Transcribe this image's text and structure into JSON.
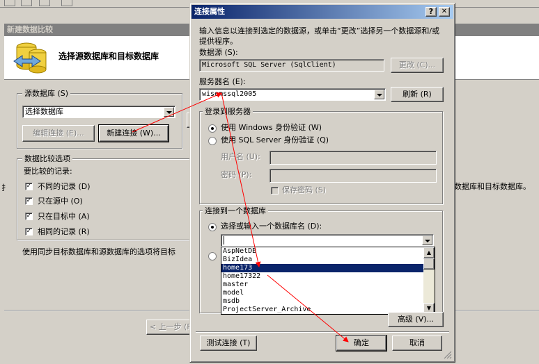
{
  "wizard": {
    "title": "新建数据比较",
    "header": "选择源数据库和目标数据库",
    "source_group": "源数据库 (S)",
    "source_select": "选择数据库",
    "edit_connection": "编辑连接 (E)...",
    "new_connection": "新建连接 (W)...",
    "options_group": "数据比较选项",
    "records_label": "要比较的记录:",
    "options": [
      {
        "label": "不同的记录 (D)",
        "checked": true
      },
      {
        "label": "只在源中 (O)",
        "checked": true
      },
      {
        "label": "只在目标中 (A)",
        "checked": true
      },
      {
        "label": "相同的记录 (R)",
        "checked": true
      }
    ],
    "sync_note": "使用同步目标数据库和源数据库的选项将目标",
    "right_text": "数据库和目标数据库。",
    "back_button": "< 上一步 (P"
  },
  "dialog": {
    "title": "连接属性",
    "help_button": "?",
    "close_button": "✕",
    "intro": "输入信息以连接到选定的数据源，或单击“更改”选择另一个数据源和/或提供程序。",
    "datasource_label": "数据源 (S):",
    "datasource_value": "Microsoft SQL Server (SqlClient)",
    "change_button": "更改 (C)...",
    "server_label": "服务器名 (E):",
    "server_value": "wisemssql2005",
    "refresh_button": "刷新 (R)",
    "login_group": "登录到服务器",
    "windows_auth": "使用 Windows 身份验证 (W)",
    "sql_auth": "使用 SQL Server 身份验证 (Q)",
    "username_label": "用户名 (U):",
    "password_label": "密码 (P):",
    "save_password": "保存密码 (S)",
    "connect_group": "连接到一个数据库",
    "select_db_label": "选择或输入一个数据库名 (D):",
    "db_value": "",
    "db_list": [
      "AspNetDB",
      "BizIdea",
      "home173",
      "home17322",
      "master",
      "model",
      "msdb",
      "ProjectServer_Archive"
    ],
    "selected_index": 2,
    "advanced_button": "高级 (V)...",
    "test_button": "测试连接 (T)",
    "ok_button": "确定",
    "cancel_button": "取消"
  },
  "colors": {
    "titlebar": "#0a246a",
    "selection": "#0a246a",
    "annotation": "#ff0000"
  }
}
